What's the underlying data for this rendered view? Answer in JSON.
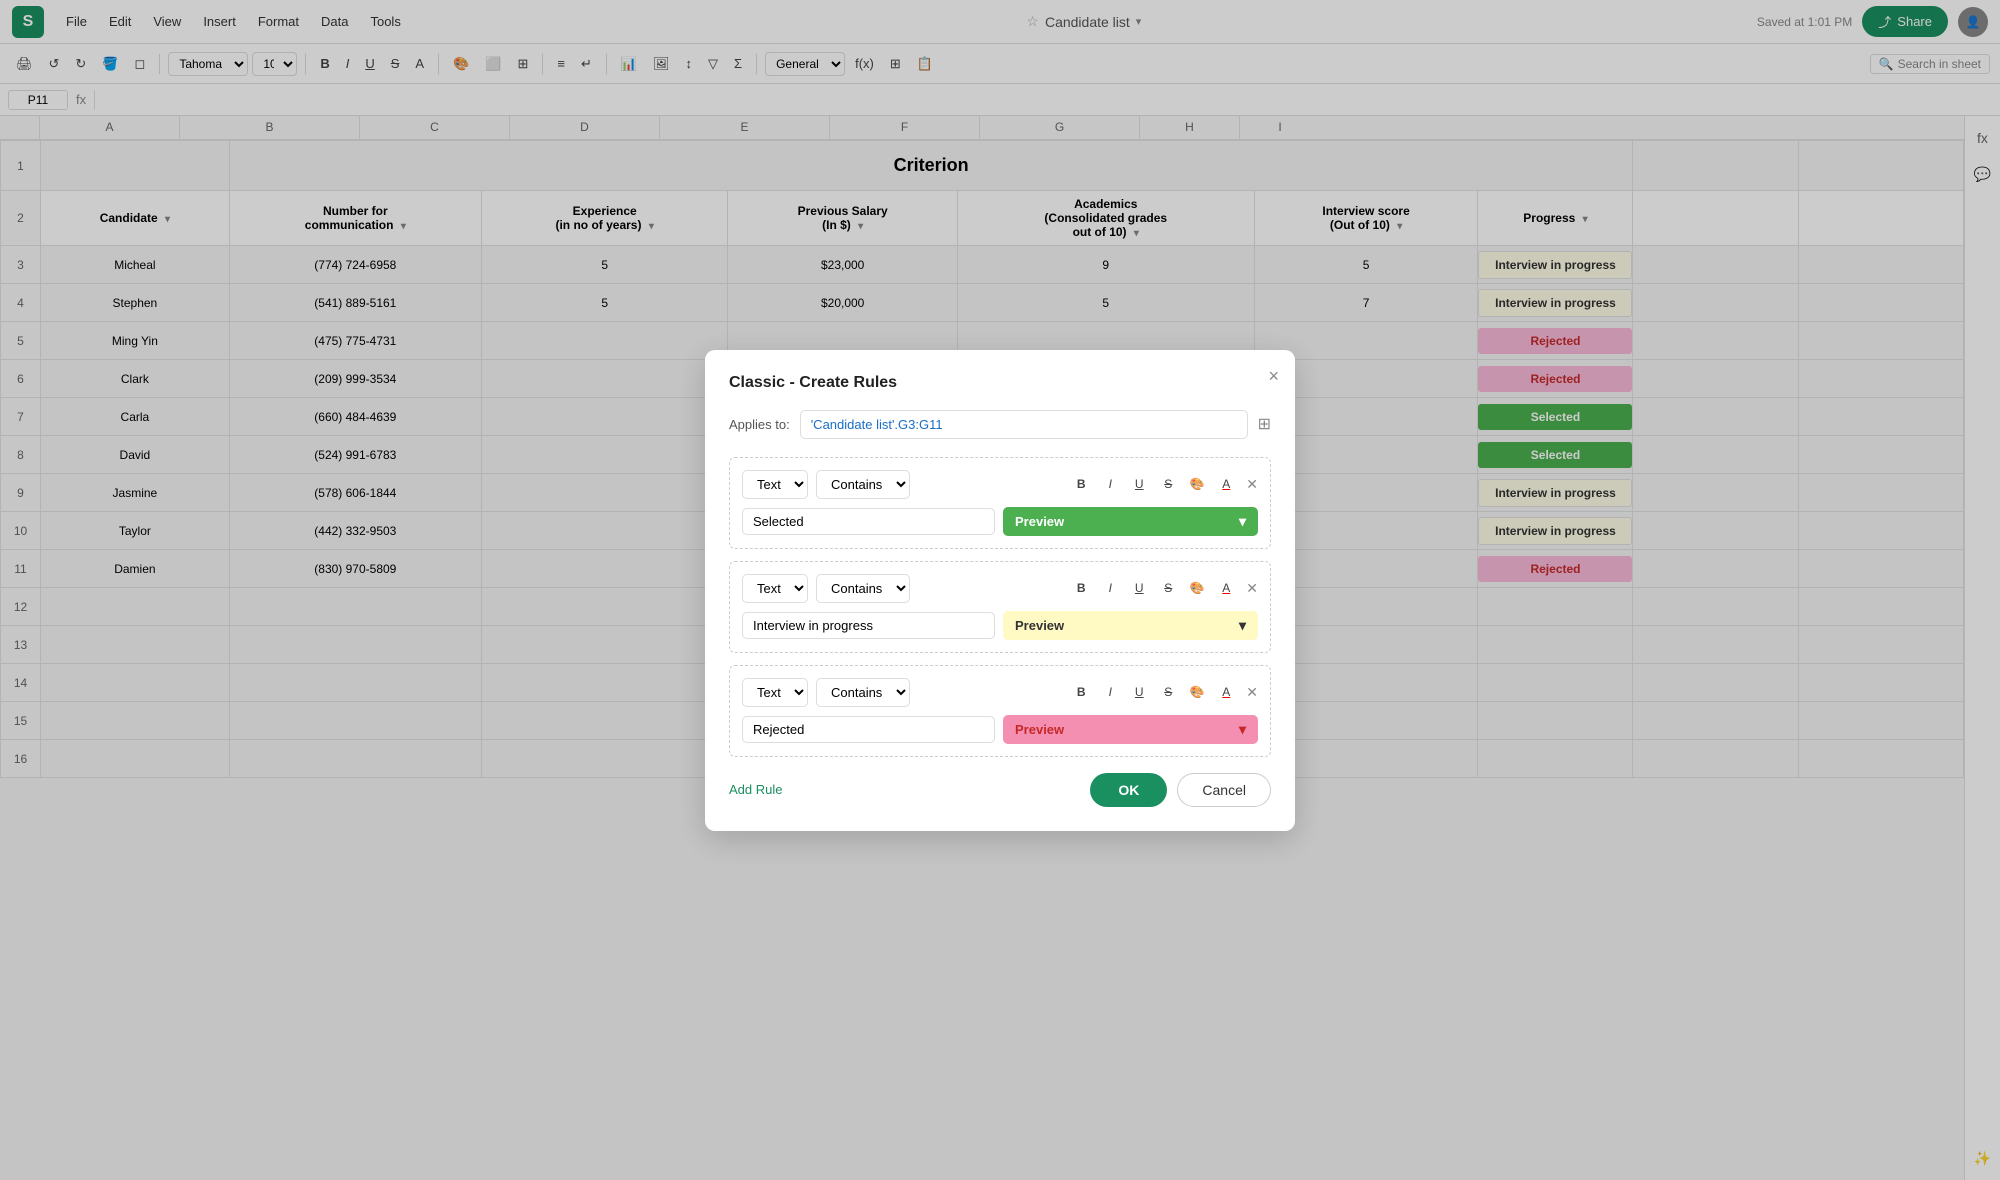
{
  "app": {
    "logo": "S",
    "menu": [
      "File",
      "Edit",
      "View",
      "Insert",
      "Format",
      "Data",
      "Tools"
    ],
    "title": "Candidate list",
    "saved_text": "Saved at 1:01 PM",
    "share_label": "Share",
    "cell_ref": "P11",
    "font": "Tahoma",
    "font_size": "10",
    "search_placeholder": "Search in sheet"
  },
  "spreadsheet": {
    "title": "Criterion",
    "columns": [
      "A",
      "B",
      "C",
      "D",
      "E",
      "F",
      "G",
      "H",
      "I"
    ],
    "row_numbers": [
      "1",
      "2",
      "3",
      "4",
      "5",
      "6",
      "7",
      "8",
      "9",
      "10",
      "11",
      "12",
      "13",
      "14",
      "15",
      "16"
    ],
    "headers": {
      "candidate": "Candidate",
      "number": "Number for\ncommunication",
      "experience": "Experience\n(in no of years)",
      "salary": "Previous Salary\n(In $)",
      "academics": "Academics\n(Consolidated grades\nout of 10)",
      "interview": "Interview score\n(Out of 10)",
      "progress": "Progress"
    },
    "rows": [
      {
        "id": 3,
        "candidate": "Micheal",
        "number": "(774) 724-6958",
        "experience": "5",
        "salary": "$23,000",
        "academics": "9",
        "interview": "5",
        "progress": "Interview in progress",
        "progress_type": "interview"
      },
      {
        "id": 4,
        "candidate": "Stephen",
        "number": "(541) 889-5161",
        "experience": "5",
        "salary": "$20,000",
        "academics": "5",
        "interview": "7",
        "progress": "Interview in progress",
        "progress_type": "interview"
      },
      {
        "id": 5,
        "candidate": "Ming Yin",
        "number": "(475) 775-4731",
        "experience": "",
        "salary": "",
        "academics": "",
        "interview": "",
        "progress": "Rejected",
        "progress_type": "rejected"
      },
      {
        "id": 6,
        "candidate": "Clark",
        "number": "(209) 999-3534",
        "experience": "",
        "salary": "",
        "academics": "",
        "interview": "",
        "progress": "Rejected",
        "progress_type": "rejected"
      },
      {
        "id": 7,
        "candidate": "Carla",
        "number": "(660) 484-4639",
        "experience": "",
        "salary": "",
        "academics": "",
        "interview": "",
        "progress": "Selected",
        "progress_type": "selected"
      },
      {
        "id": 8,
        "candidate": "David",
        "number": "(524) 991-6783",
        "experience": "",
        "salary": "",
        "academics": "",
        "interview": "",
        "progress": "Selected",
        "progress_type": "selected"
      },
      {
        "id": 9,
        "candidate": "Jasmine",
        "number": "(578) 606-1844",
        "experience": "",
        "salary": "",
        "academics": "",
        "interview": "",
        "progress": "Interview in progress",
        "progress_type": "interview"
      },
      {
        "id": 10,
        "candidate": "Taylor",
        "number": "(442) 332-9503",
        "experience": "",
        "salary": "",
        "academics": "",
        "interview": "",
        "progress": "Interview in progress",
        "progress_type": "interview"
      },
      {
        "id": 11,
        "candidate": "Damien",
        "number": "(830) 970-5809",
        "experience": "",
        "salary": "",
        "academics": "",
        "interview": "",
        "progress": "Rejected",
        "progress_type": "rejected"
      }
    ]
  },
  "modal": {
    "title": "Classic - Create Rules",
    "applies_label": "Applies to:",
    "applies_value": "'Candidate list'.G3:G11",
    "close_label": "×",
    "rules": [
      {
        "id": 1,
        "type_label": "Text",
        "condition_label": "Contains",
        "value": "Selected",
        "preview_label": "Preview",
        "preview_type": "green"
      },
      {
        "id": 2,
        "type_label": "Text",
        "condition_label": "Contains",
        "value": "Interview in progress",
        "preview_label": "Preview",
        "preview_type": "yellow"
      },
      {
        "id": 3,
        "type_label": "Text",
        "condition_label": "Contains",
        "value": "Rejected",
        "preview_label": "Preview",
        "preview_type": "pink"
      }
    ],
    "add_rule_label": "Add Rule",
    "ok_label": "OK",
    "cancel_label": "Cancel"
  },
  "toolbar": {
    "bold": "B",
    "italic": "I",
    "underline": "U",
    "strikethrough": "S"
  }
}
